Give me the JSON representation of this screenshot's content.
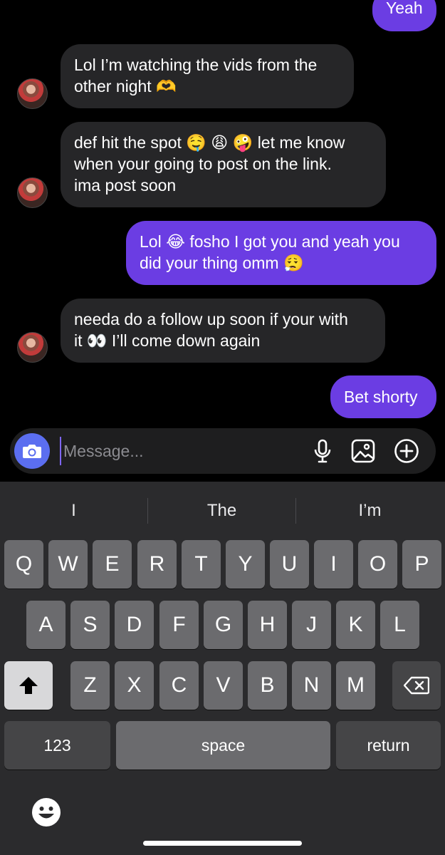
{
  "messages": [
    {
      "id": "m0",
      "side": "out",
      "text": "Yeah"
    },
    {
      "id": "m1",
      "side": "in",
      "lines": [
        "Lol I’m watching the vids from the",
        "other night 🫶"
      ]
    },
    {
      "id": "m2",
      "side": "in",
      "lines": [
        "def hit the spot 🤤 😩 🤪 let me know",
        "when your going to post on the link.",
        "ima post soon"
      ]
    },
    {
      "id": "m3",
      "side": "out",
      "lines": [
        "Lol 😂 fosho I got you and yeah you",
        "did your thing omm 😮‍💨"
      ]
    },
    {
      "id": "m4",
      "side": "in",
      "lines": [
        "needa do a follow up soon if your with",
        "it 👀 I’ll come down again"
      ]
    },
    {
      "id": "m5",
      "side": "out",
      "text": "Bet shorty"
    }
  ],
  "composer": {
    "placeholder": "Message...",
    "camera_icon": "camera-icon",
    "mic_icon": "microphone-icon",
    "gallery_icon": "image-icon",
    "add_icon": "plus-circle-icon"
  },
  "keyboard": {
    "suggestions": [
      "I",
      "The",
      "I’m"
    ],
    "row1": [
      "Q",
      "W",
      "E",
      "R",
      "T",
      "Y",
      "U",
      "I",
      "O",
      "P"
    ],
    "row2": [
      "A",
      "S",
      "D",
      "F",
      "G",
      "H",
      "J",
      "K",
      "L"
    ],
    "row3": [
      "Z",
      "X",
      "C",
      "V",
      "B",
      "N",
      "M"
    ],
    "numbers_label": "123",
    "space_label": "space",
    "return_label": "return",
    "shift_icon": "shift-icon",
    "delete_icon": "backspace-icon",
    "emoji_icon": "emoji-icon"
  },
  "colors": {
    "outgoing": "#6b3de3",
    "incoming": "#262628",
    "camera": "#5b6ef0"
  }
}
